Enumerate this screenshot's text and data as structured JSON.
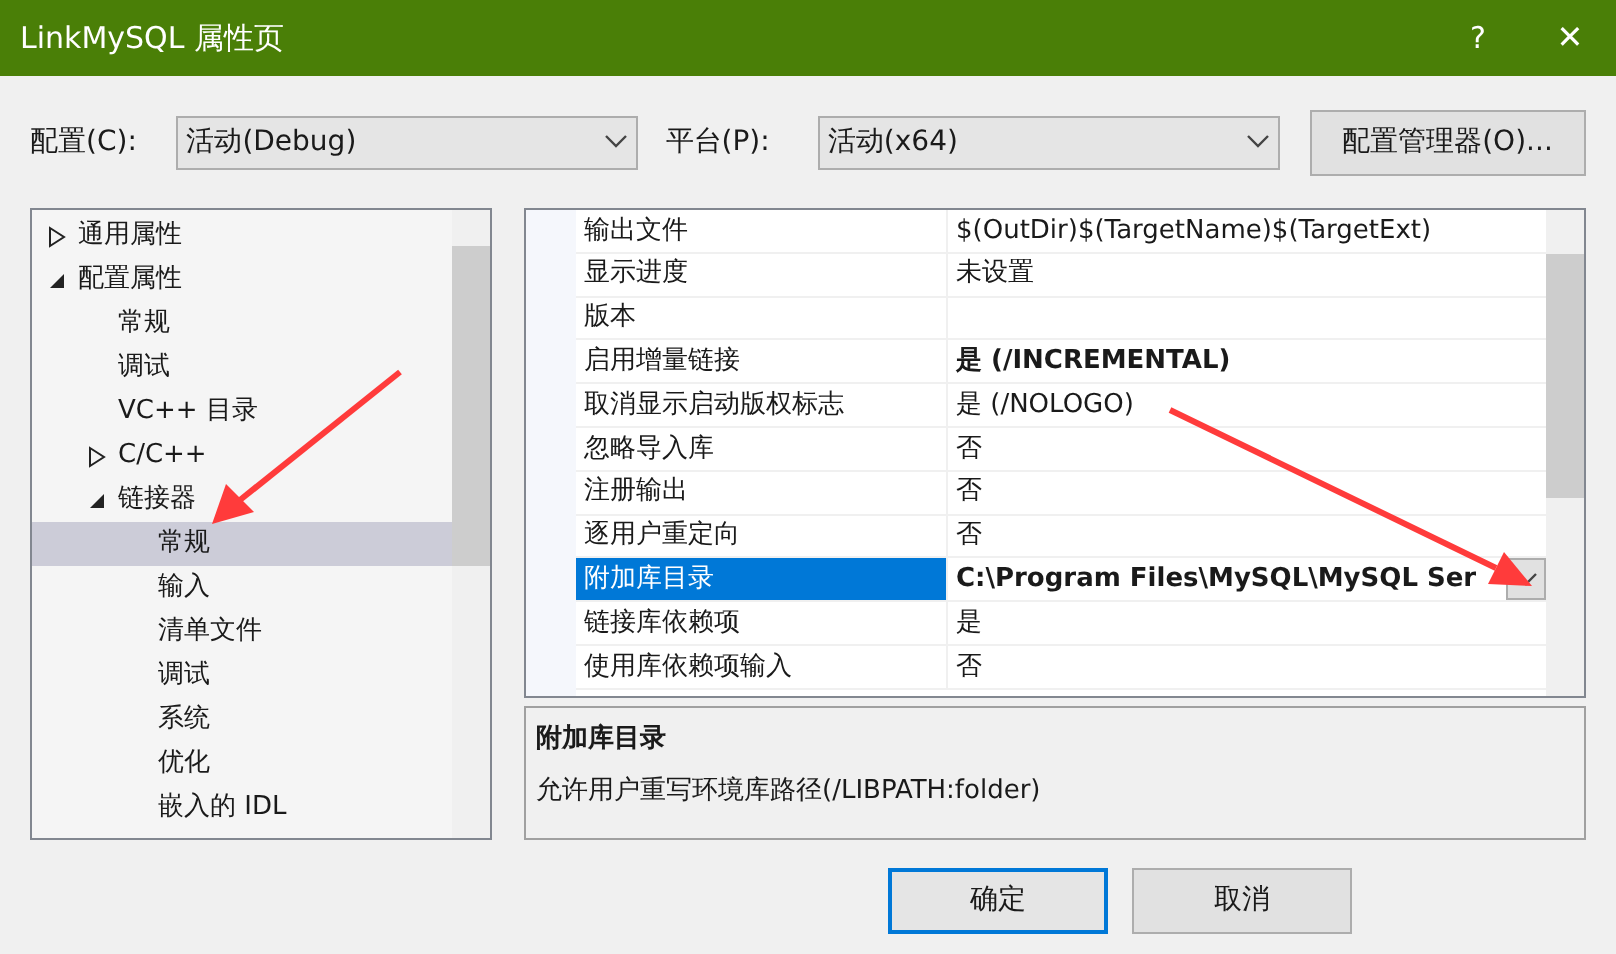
{
  "window": {
    "title": "LinkMySQL 属性页",
    "help": "?",
    "close": "✕"
  },
  "config_bar": {
    "config_label": "配置(C):",
    "config_value": "活动(Debug)",
    "platform_label": "平台(P):",
    "platform_value": "活动(x64)",
    "manager_button": "配置管理器(O)..."
  },
  "tree": [
    {
      "label": "通用属性",
      "expanded": false,
      "selected": false
    },
    {
      "label": "配置属性",
      "expanded": true,
      "selected": false,
      "children": [
        {
          "label": "常规",
          "selected": false
        },
        {
          "label": "调试",
          "selected": false
        },
        {
          "label": "VC++ 目录",
          "selected": false
        },
        {
          "label": "C/C++",
          "expanded": false,
          "selected": false
        },
        {
          "label": "链接器",
          "expanded": true,
          "selected": false,
          "children": [
            {
              "label": "常规",
              "selected": true
            },
            {
              "label": "输入",
              "selected": false
            },
            {
              "label": "清单文件",
              "selected": false
            },
            {
              "label": "调试",
              "selected": false
            },
            {
              "label": "系统",
              "selected": false
            },
            {
              "label": "优化",
              "selected": false
            },
            {
              "label": "嵌入的 IDL",
              "selected": false
            }
          ]
        }
      ]
    }
  ],
  "properties": [
    {
      "name": "输出文件",
      "value": "$(OutDir)$(TargetName)$(TargetExt)",
      "selected": false,
      "modified": false
    },
    {
      "name": "显示进度",
      "value": "未设置",
      "selected": false,
      "modified": false
    },
    {
      "name": "版本",
      "selected": false
    },
    {
      "name": "启用增量链接",
      "value": "是 (/INCREMENTAL)",
      "selected": false,
      "modified": true
    },
    {
      "name": "取消显示启动版权标志",
      "value": "是 (/NOLOGO)",
      "selected": false,
      "modified": false
    },
    {
      "name": "忽略导入库",
      "value": "否",
      "selected": false,
      "modified": false
    },
    {
      "name": "注册输出",
      "value": "否",
      "selected": false,
      "modified": false
    },
    {
      "name": "逐用户重定向",
      "value": "否",
      "selected": false,
      "modified": false
    },
    {
      "name": "附加库目录",
      "value": "C:\\Program Files\\MySQL\\MySQL Ser",
      "selected": true,
      "modified": true
    },
    {
      "name": "链接库依赖项",
      "value": "是",
      "selected": false,
      "modified": false
    },
    {
      "name": "使用库依赖项输入",
      "value": "否",
      "selected": false,
      "modified": false
    }
  ],
  "description": {
    "title": "附加库目录",
    "text": "允许用户重写环境库路径(/LIBPATH:folder)"
  },
  "buttons": [
    {
      "label": "确定",
      "default": true
    },
    {
      "label": "取消",
      "default": false
    }
  ]
}
